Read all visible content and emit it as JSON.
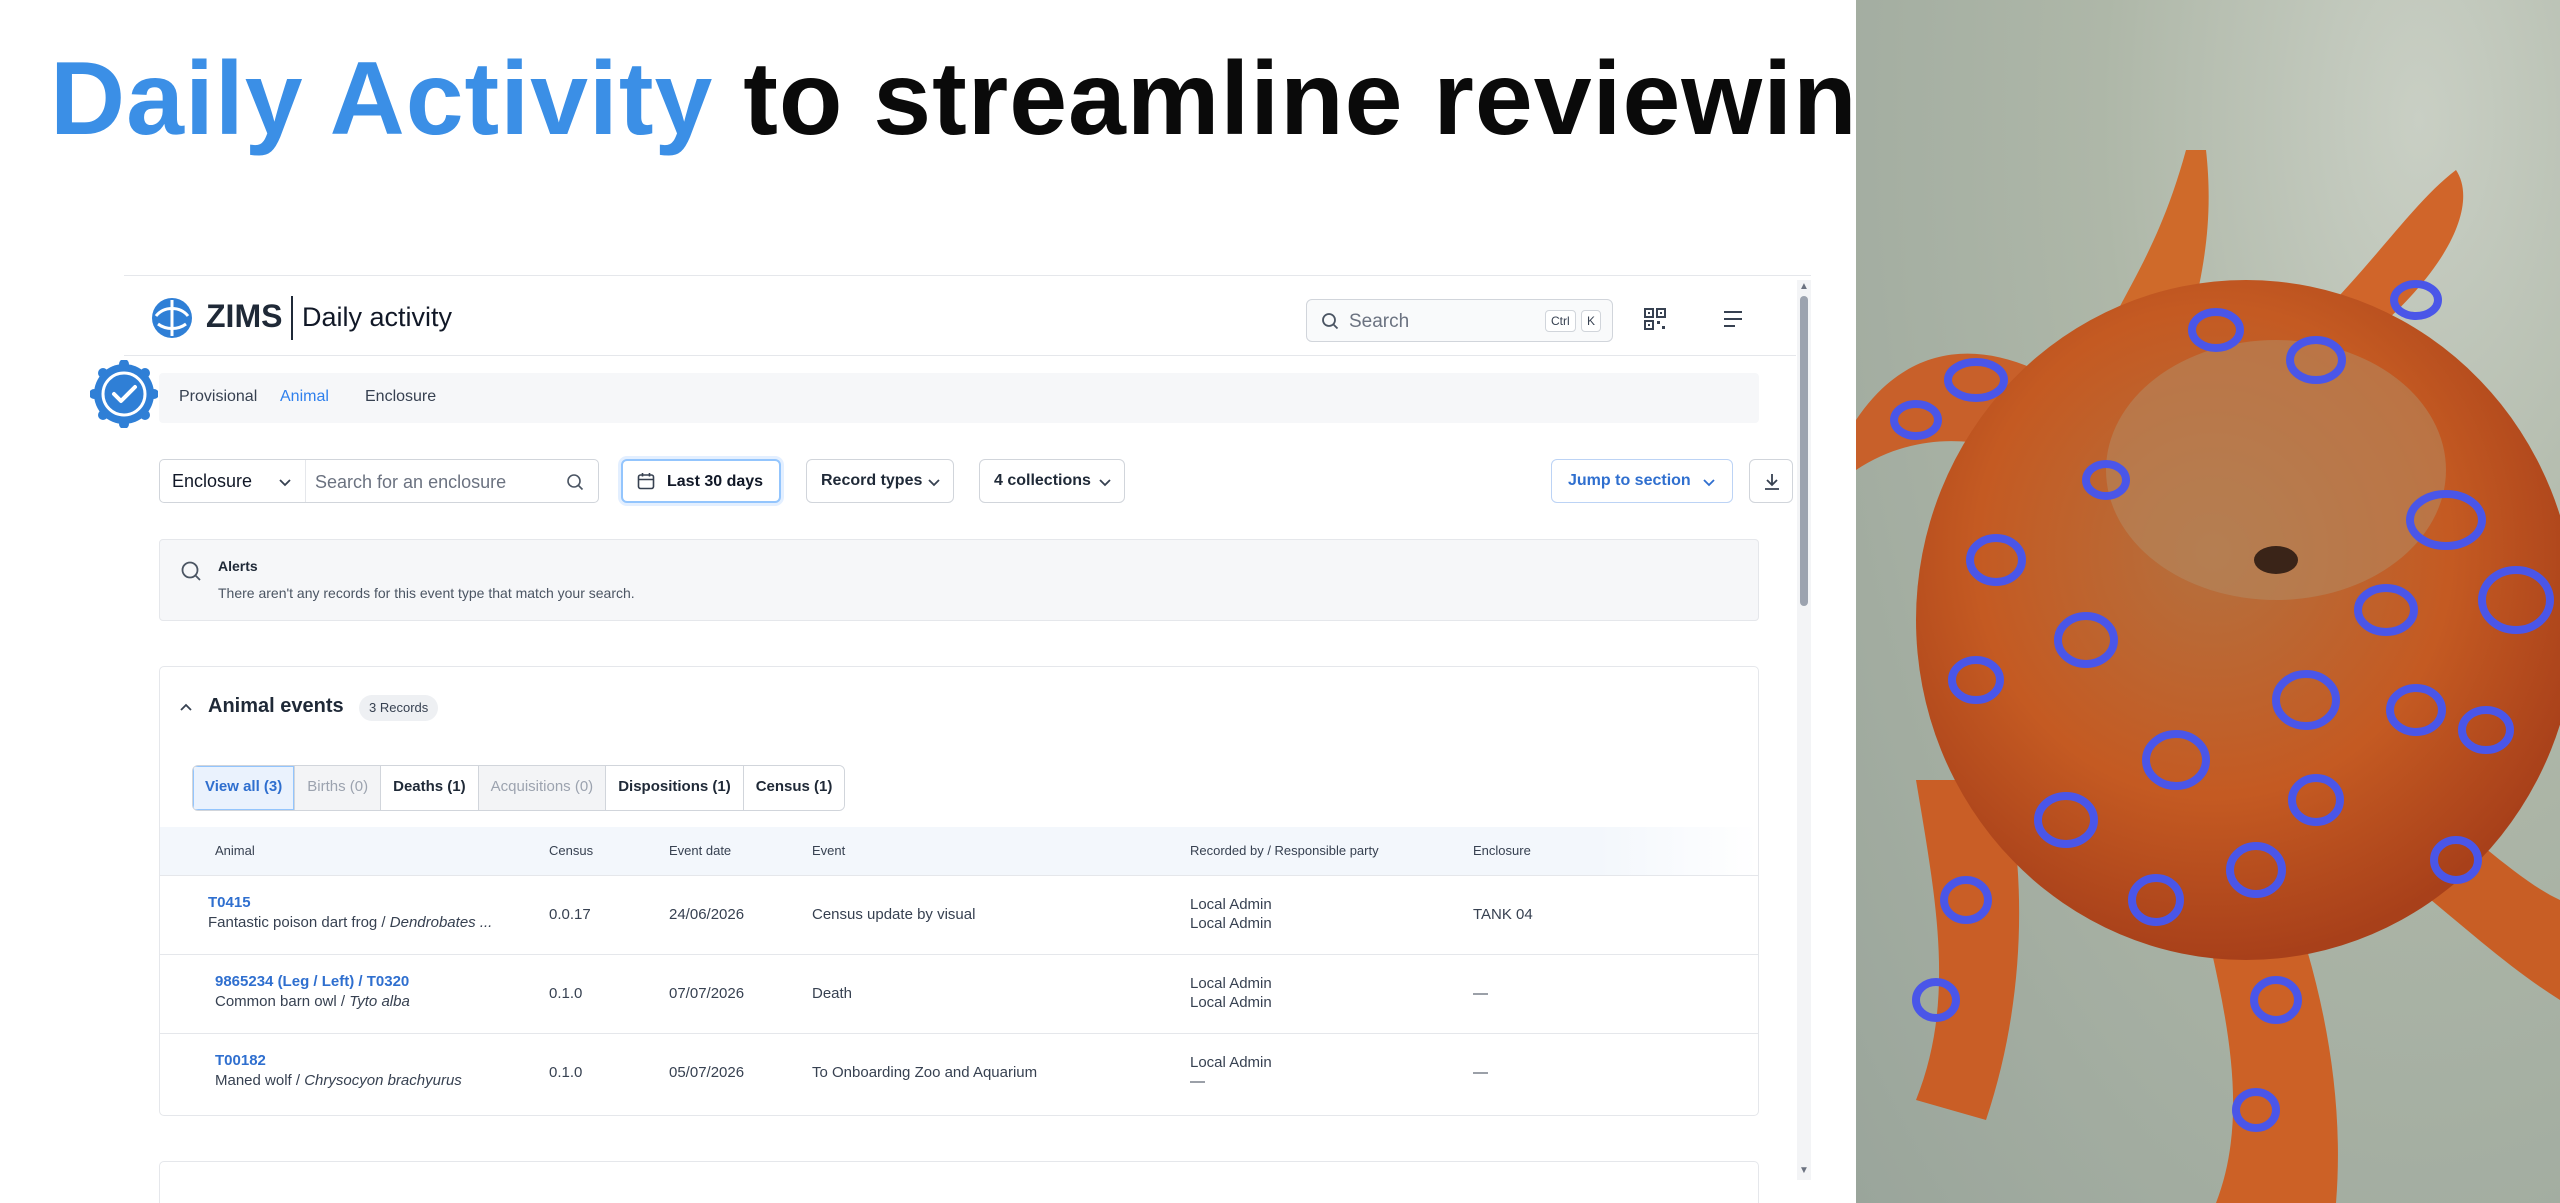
{
  "headline": {
    "accent": "Daily Activity",
    "rest": "to streamline reviewing"
  },
  "colors": {
    "accent": "#3b8fe6",
    "link": "#2f6fcf"
  },
  "app": {
    "brand": "ZIMS",
    "title": "Daily activity",
    "search": {
      "placeholder": "Search",
      "kbd1": "Ctrl",
      "kbd2": "K"
    },
    "icons": [
      "search-icon",
      "qr-code-icon",
      "menu-icon",
      "calendar-icon",
      "download-icon",
      "chevron-down-icon",
      "verified-badge-icon"
    ]
  },
  "subtabs": [
    {
      "label": "Provisional",
      "active": false
    },
    {
      "label": "Animal",
      "active": true
    },
    {
      "label": "Enclosure",
      "active": false
    }
  ],
  "filters": {
    "enclosure_select": "Enclosure",
    "enclosure_placeholder": "Search for an enclosure",
    "date_range": "Last 30 days",
    "record_types": "Record types",
    "collections": "4 collections",
    "jump": "Jump to section"
  },
  "alerts": {
    "title": "Alerts",
    "message": "There aren't any records for this event type that match your search."
  },
  "animal_events": {
    "title": "Animal events",
    "badge": "3 Records",
    "segments": [
      {
        "label": "View all (3)",
        "state": "active"
      },
      {
        "label": "Births (0)",
        "state": "disabled"
      },
      {
        "label": "Deaths (1)",
        "state": "normal"
      },
      {
        "label": "Acquisitions (0)",
        "state": "disabled"
      },
      {
        "label": "Dispositions (1)",
        "state": "normal"
      },
      {
        "label": "Census (1)",
        "state": "normal"
      }
    ],
    "columns": [
      "Animal",
      "Census",
      "Event date",
      "Event",
      "Recorded by / Responsible party",
      "Enclosure"
    ],
    "rows": [
      {
        "id": "T0415",
        "common": "Fantastic poison dart frog / ",
        "sci": "Dendrobates ...",
        "census": "0.0.17",
        "date": "24/06/2026",
        "event": "Census update by visual",
        "rec1": "Local Admin",
        "rec2": "Local Admin",
        "enclosure": "TANK 04"
      },
      {
        "id": "9865234 (Leg / Left) / T0320",
        "common": "Common barn owl / ",
        "sci": "Tyto alba",
        "census": "0.1.0",
        "date": "07/07/2026",
        "event": "Death",
        "rec1": "Local Admin",
        "rec2": "Local Admin",
        "enclosure": "—"
      },
      {
        "id": "T00182",
        "common": "Maned wolf / ",
        "sci": "Chrysocyon brachyurus",
        "census": "0.1.0",
        "date": "05/07/2026",
        "event": "To Onboarding Zoo and Aquarium",
        "rec1": "Local Admin",
        "rec2": "—",
        "enclosure": "—"
      }
    ]
  }
}
